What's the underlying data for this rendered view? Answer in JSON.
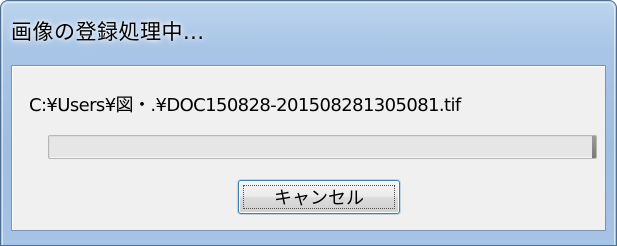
{
  "window": {
    "title": "画像の登録処理中..."
  },
  "dialog": {
    "file_path": "C:¥Users¥図・.¥DOC150828-201508281305081.tif",
    "progress_value": 0,
    "cancel_label": "キャンセル"
  },
  "colors": {
    "title_bar": "#a9c5e6",
    "client_bg": "#f0f0f0",
    "button_border": "#3c7fb1",
    "progress_track": "#e6e6e6"
  }
}
